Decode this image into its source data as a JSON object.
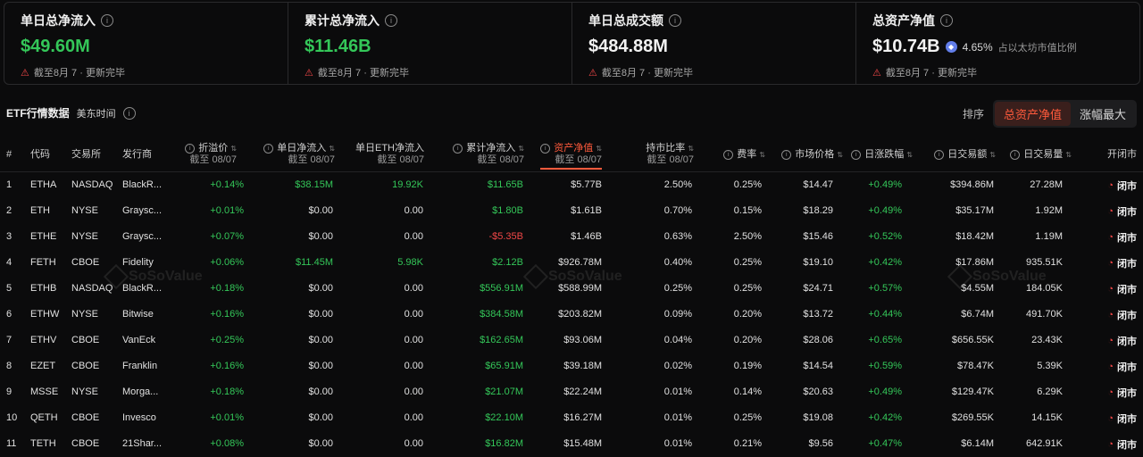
{
  "cards": [
    {
      "title": "单日总净流入",
      "value": "$49.60M",
      "value_color": "#34c759",
      "note": "截至8月 7 · 更新完毕"
    },
    {
      "title": "累计总净流入",
      "value": "$11.46B",
      "value_color": "#34c759",
      "note": "截至8月 7 · 更新完毕"
    },
    {
      "title": "单日总成交额",
      "value": "$484.88M",
      "value_color": "#f2f2f2",
      "note": "截至8月 7 · 更新完毕"
    },
    {
      "title": "总资产净值",
      "value": "$10.74B",
      "value_color": "#f2f2f2",
      "pct": "4.65%",
      "pct_label": "占以太坊市值比例",
      "note": "截至8月 7 · 更新完毕"
    }
  ],
  "section": {
    "title": "ETF行情数据",
    "timezone": "美东时间"
  },
  "sort": {
    "label": "排序",
    "options": [
      "总资产净值",
      "涨幅最大"
    ],
    "active": 0
  },
  "columns": {
    "num": "#",
    "code": "代码",
    "exchange": "交易所",
    "issuer": "发行商",
    "premium": "折溢价",
    "premium_sub": "截至 08/07",
    "daily_inflow": "单日净流入",
    "daily_inflow_sub": "截至 08/07",
    "daily_eth_inflow": "单日ETH净流入",
    "daily_eth_inflow_sub": "截至 08/07",
    "cum_inflow": "累计净流入",
    "cum_inflow_sub": "截至 08/07",
    "nav": "资产净值",
    "nav_sub": "截至 08/07",
    "share": "持市比率",
    "share_sub": "截至 08/07",
    "fee": "费率",
    "price": "市场价格",
    "change": "日涨跌幅",
    "volume_usd": "日交易额",
    "volume": "日交易量",
    "status": "开闭市"
  },
  "rows": [
    {
      "n": "1",
      "code": "ETHA",
      "ex": "NASDAQ",
      "issuer": "BlackR...",
      "premium": "+0.14%",
      "daily": "$38.15M",
      "daily_g": true,
      "eth": "19.92K",
      "eth_g": true,
      "cum": "$11.65B",
      "cum_c": "g",
      "nav": "$5.77B",
      "share": "2.50%",
      "fee": "0.25%",
      "price": "$14.47",
      "chg": "+0.49%",
      "vol_usd": "$394.86M",
      "vol": "27.28M",
      "status": "闭市"
    },
    {
      "n": "2",
      "code": "ETH",
      "ex": "NYSE",
      "issuer": "Graysc...",
      "premium": "+0.01%",
      "daily": "$0.00",
      "daily_g": false,
      "eth": "0.00",
      "eth_g": false,
      "cum": "$1.80B",
      "cum_c": "g",
      "nav": "$1.61B",
      "share": "0.70%",
      "fee": "0.15%",
      "price": "$18.29",
      "chg": "+0.49%",
      "vol_usd": "$35.17M",
      "vol": "1.92M",
      "status": "闭市"
    },
    {
      "n": "3",
      "code": "ETHE",
      "ex": "NYSE",
      "issuer": "Graysc...",
      "premium": "+0.07%",
      "daily": "$0.00",
      "daily_g": false,
      "eth": "0.00",
      "eth_g": false,
      "cum": "-$5.35B",
      "cum_c": "rd",
      "nav": "$1.46B",
      "share": "0.63%",
      "fee": "2.50%",
      "price": "$15.46",
      "chg": "+0.52%",
      "vol_usd": "$18.42M",
      "vol": "1.19M",
      "status": "闭市"
    },
    {
      "n": "4",
      "code": "FETH",
      "ex": "CBOE",
      "issuer": "Fidelity",
      "premium": "+0.06%",
      "daily": "$11.45M",
      "daily_g": true,
      "eth": "5.98K",
      "eth_g": true,
      "cum": "$2.12B",
      "cum_c": "g",
      "nav": "$926.78M",
      "share": "0.40%",
      "fee": "0.25%",
      "price": "$19.10",
      "chg": "+0.42%",
      "vol_usd": "$17.86M",
      "vol": "935.51K",
      "status": "闭市"
    },
    {
      "n": "5",
      "code": "ETHB",
      "ex": "NASDAQ",
      "issuer": "BlackR...",
      "premium": "+0.18%",
      "daily": "$0.00",
      "daily_g": false,
      "eth": "0.00",
      "eth_g": false,
      "cum": "$556.91M",
      "cum_c": "g",
      "nav": "$588.99M",
      "share": "0.25%",
      "fee": "0.25%",
      "price": "$24.71",
      "chg": "+0.57%",
      "vol_usd": "$4.55M",
      "vol": "184.05K",
      "status": "闭市"
    },
    {
      "n": "6",
      "code": "ETHW",
      "ex": "NYSE",
      "issuer": "Bitwise",
      "premium": "+0.16%",
      "daily": "$0.00",
      "daily_g": false,
      "eth": "0.00",
      "eth_g": false,
      "cum": "$384.58M",
      "cum_c": "g",
      "nav": "$203.82M",
      "share": "0.09%",
      "fee": "0.20%",
      "price": "$13.72",
      "chg": "+0.44%",
      "vol_usd": "$6.74M",
      "vol": "491.70K",
      "status": "闭市"
    },
    {
      "n": "7",
      "code": "ETHV",
      "ex": "CBOE",
      "issuer": "VanEck",
      "premium": "+0.25%",
      "daily": "$0.00",
      "daily_g": false,
      "eth": "0.00",
      "eth_g": false,
      "cum": "$162.65M",
      "cum_c": "g",
      "nav": "$93.06M",
      "share": "0.04%",
      "fee": "0.20%",
      "price": "$28.06",
      "chg": "+0.65%",
      "vol_usd": "$656.55K",
      "vol": "23.43K",
      "status": "闭市"
    },
    {
      "n": "8",
      "code": "EZET",
      "ex": "CBOE",
      "issuer": "Franklin",
      "premium": "+0.16%",
      "daily": "$0.00",
      "daily_g": false,
      "eth": "0.00",
      "eth_g": false,
      "cum": "$65.91M",
      "cum_c": "g",
      "nav": "$39.18M",
      "share": "0.02%",
      "fee": "0.19%",
      "price": "$14.54",
      "chg": "+0.59%",
      "vol_usd": "$78.47K",
      "vol": "5.39K",
      "status": "闭市"
    },
    {
      "n": "9",
      "code": "MSSE",
      "ex": "NYSE",
      "issuer": "Morga...",
      "premium": "+0.18%",
      "daily": "$0.00",
      "daily_g": false,
      "eth": "0.00",
      "eth_g": false,
      "cum": "$21.07M",
      "cum_c": "g",
      "nav": "$22.24M",
      "share": "0.01%",
      "fee": "0.14%",
      "price": "$20.63",
      "chg": "+0.49%",
      "vol_usd": "$129.47K",
      "vol": "6.29K",
      "status": "闭市"
    },
    {
      "n": "10",
      "code": "QETH",
      "ex": "CBOE",
      "issuer": "Invesco",
      "premium": "+0.01%",
      "daily": "$0.00",
      "daily_g": false,
      "eth": "0.00",
      "eth_g": false,
      "cum": "$22.10M",
      "cum_c": "g",
      "nav": "$16.27M",
      "share": "0.01%",
      "fee": "0.25%",
      "price": "$19.08",
      "chg": "+0.42%",
      "vol_usd": "$269.55K",
      "vol": "14.15K",
      "status": "闭市"
    },
    {
      "n": "11",
      "code": "TETH",
      "ex": "CBOE",
      "issuer": "21Shar...",
      "premium": "+0.08%",
      "daily": "$0.00",
      "daily_g": false,
      "eth": "0.00",
      "eth_g": false,
      "cum": "$16.82M",
      "cum_c": "g",
      "nav": "$15.48M",
      "share": "0.01%",
      "fee": "0.21%",
      "price": "$9.56",
      "chg": "+0.47%",
      "vol_usd": "$6.14M",
      "vol": "642.91K",
      "status": "闭市"
    }
  ],
  "watermark": "SoSoValue"
}
